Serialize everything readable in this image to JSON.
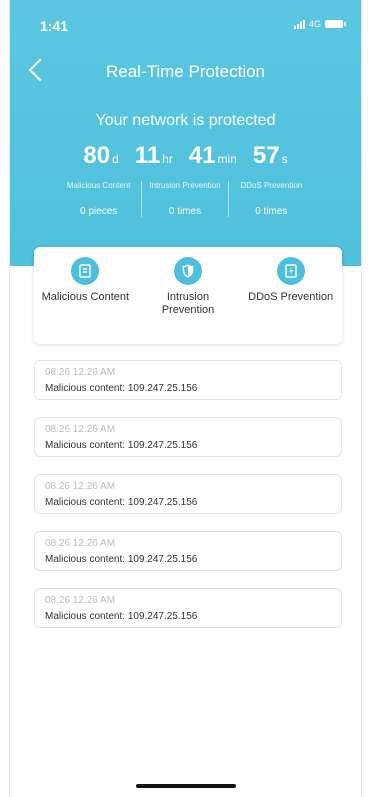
{
  "status_bar": {
    "time": "1:41",
    "network": "4G"
  },
  "header": {
    "title": "Real-Time Protection",
    "headline": "Your network is protected"
  },
  "timer": {
    "days": "80",
    "days_unit": "d",
    "hours": "11",
    "hours_unit": "hr",
    "minutes": "41",
    "minutes_unit": "min",
    "seconds": "57",
    "seconds_unit": "s"
  },
  "stats": [
    {
      "label": "Malicious Content",
      "value": "0 pieces"
    },
    {
      "label": "Intrusion Prevention",
      "value": "0 times"
    },
    {
      "label": "DDoS Prevention",
      "value": "0 times"
    }
  ],
  "features": [
    {
      "label": "Malicious Content",
      "icon": "malicious-content-icon"
    },
    {
      "label": "Intrusion Prevention",
      "icon": "shield-icon"
    },
    {
      "label": "DDoS Prevention",
      "icon": "ddos-icon"
    }
  ],
  "logs": [
    {
      "time": "08.26   12.26 AM",
      "text": "Malicious content: 109.247.25.156"
    },
    {
      "time": "08.26   12.26 AM",
      "text": "Malicious content: 109.247.25.156"
    },
    {
      "time": "08.26   12.26 AM",
      "text": "Malicious content: 109.247.25.156"
    },
    {
      "time": "08.26   12.26 AM",
      "text": "Malicious content: 109.247.25.156"
    },
    {
      "time": "08.26   12.26 AM",
      "text": "Malicious content: 109.247.25.156"
    }
  ],
  "colors": {
    "accent": "#4fc0dc",
    "text": "#333333",
    "muted": "#b7bdc2"
  }
}
